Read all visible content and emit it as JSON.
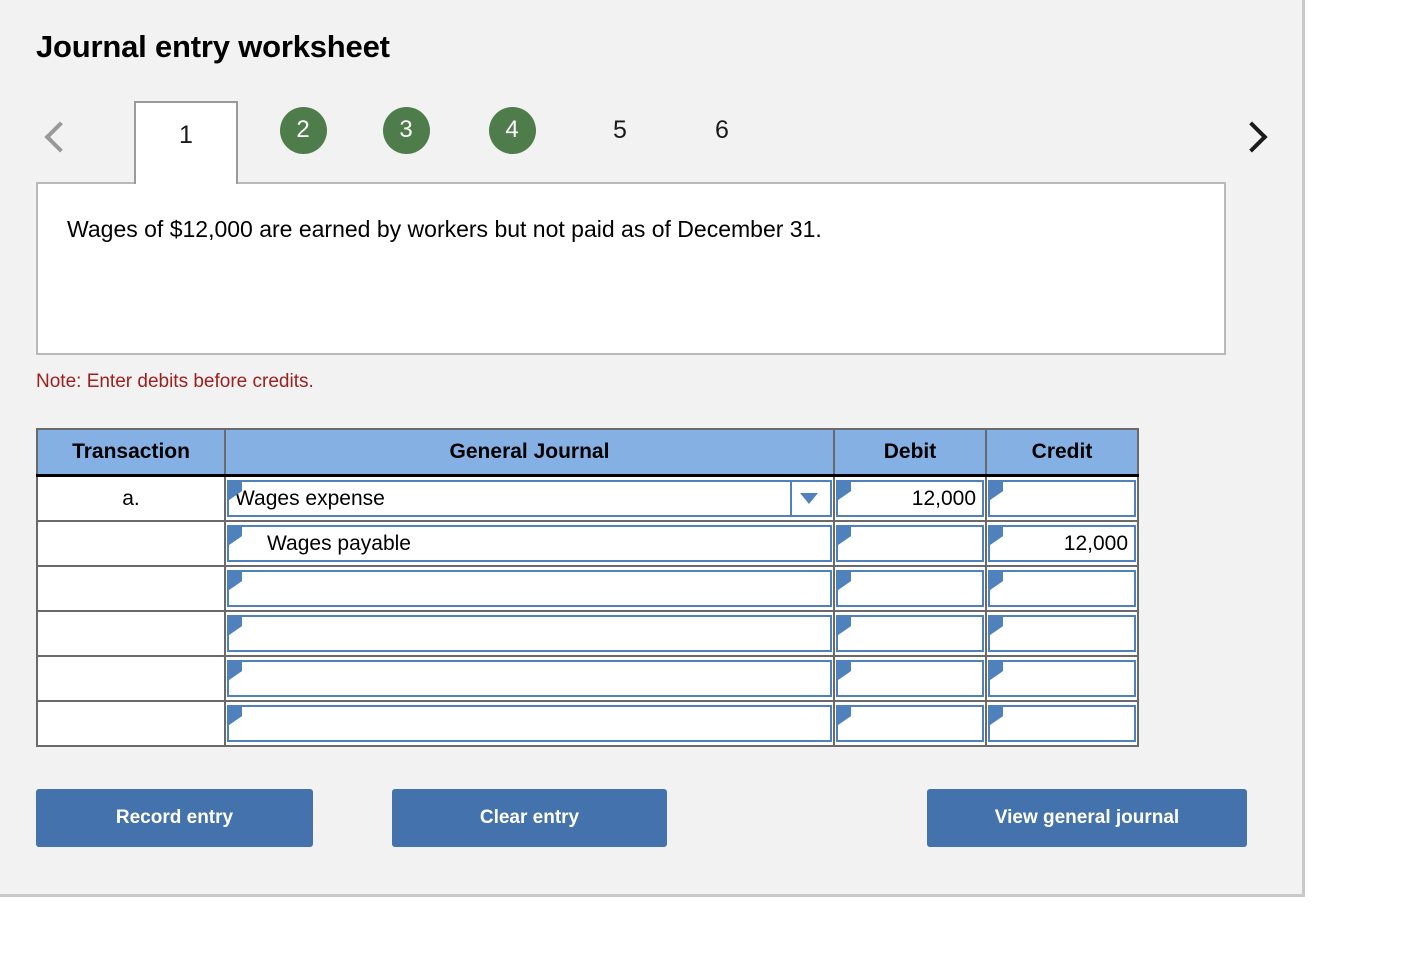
{
  "page": {
    "title": "Journal entry worksheet"
  },
  "tabs": {
    "prev_label": "‹",
    "next_label": "›",
    "items": [
      {
        "label": "1",
        "state": "active"
      },
      {
        "label": "2",
        "state": "done"
      },
      {
        "label": "3",
        "state": "done"
      },
      {
        "label": "4",
        "state": "done"
      },
      {
        "label": "5",
        "state": "pending"
      },
      {
        "label": "6",
        "state": "pending"
      }
    ]
  },
  "prompt": {
    "text": "Wages of $12,000 are earned by workers but not paid as of December 31."
  },
  "note": {
    "text": "Note: Enter debits before credits."
  },
  "table": {
    "headers": {
      "transaction": "Transaction",
      "general_journal": "General Journal",
      "debit": "Debit",
      "credit": "Credit"
    },
    "rows": [
      {
        "transaction": "a.",
        "account": "Wages expense",
        "indent": false,
        "has_dropdown": true,
        "debit": "12,000",
        "credit": ""
      },
      {
        "transaction": "",
        "account": "Wages payable",
        "indent": true,
        "has_dropdown": false,
        "debit": "",
        "credit": "12,000"
      },
      {
        "transaction": "",
        "account": "",
        "indent": false,
        "has_dropdown": false,
        "debit": "",
        "credit": ""
      },
      {
        "transaction": "",
        "account": "",
        "indent": false,
        "has_dropdown": false,
        "debit": "",
        "credit": ""
      },
      {
        "transaction": "",
        "account": "",
        "indent": false,
        "has_dropdown": false,
        "debit": "",
        "credit": ""
      },
      {
        "transaction": "",
        "account": "",
        "indent": false,
        "has_dropdown": false,
        "debit": "",
        "credit": ""
      }
    ]
  },
  "buttons": {
    "record": "Record entry",
    "clear": "Clear entry",
    "view": "View general journal"
  },
  "colors": {
    "header_blue": "#85b0e4",
    "button_blue": "#4472ac",
    "badge_green": "#4e7c4a",
    "note_red": "#9d2020",
    "field_border": "#4f81bd",
    "panel_bg": "#f2f2f2"
  }
}
